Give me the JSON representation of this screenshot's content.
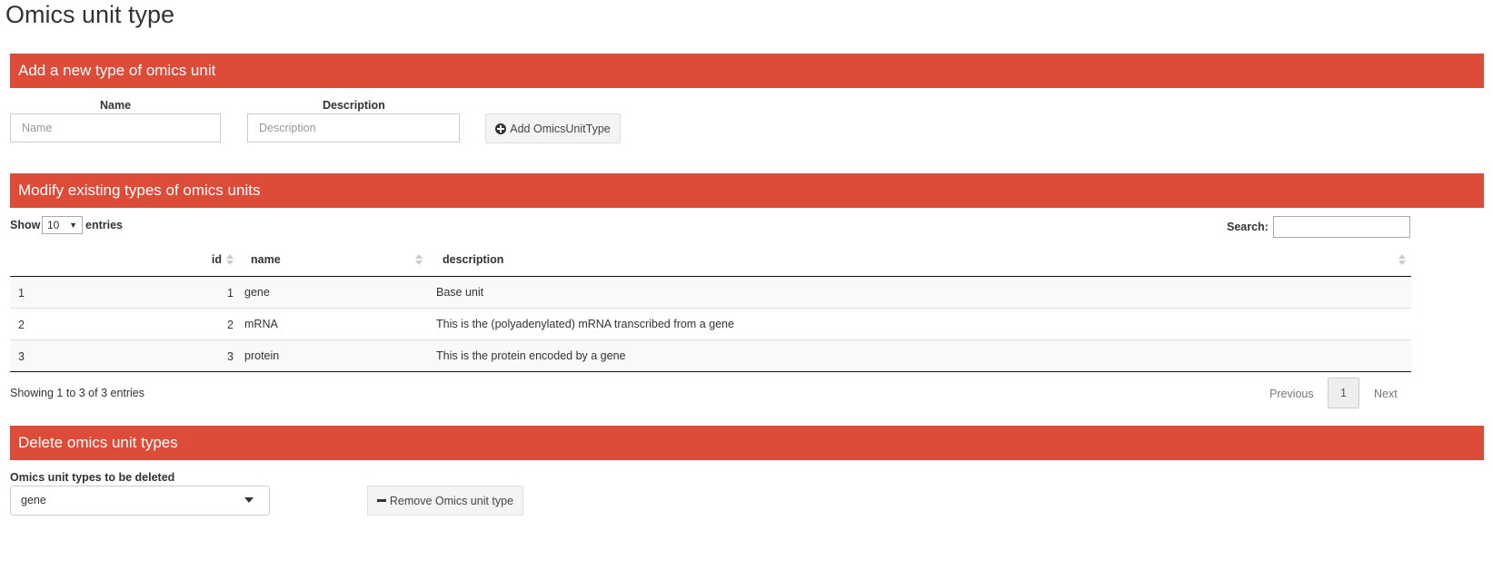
{
  "page": {
    "title": "Omics unit type"
  },
  "add_section": {
    "title": "Add a new type of omics unit",
    "name_label": "Name",
    "name_placeholder": "Name",
    "description_label": "Description",
    "description_placeholder": "Description",
    "add_button": "Add OmicsUnitType"
  },
  "modify_section": {
    "title": "Modify existing types of omics units",
    "show_label": "Show",
    "entries_value": "10",
    "entries_label": "entries",
    "search_label": "Search:",
    "columns": [
      "id",
      "name",
      "description"
    ],
    "rows": [
      {
        "row": "1",
        "id": "1",
        "name": "gene",
        "description": "Base unit"
      },
      {
        "row": "2",
        "id": "2",
        "name": "mRNA",
        "description": "This is the (polyadenylated) mRNA transcribed from a gene"
      },
      {
        "row": "3",
        "id": "3",
        "name": "protein",
        "description": "This is the protein encoded by a gene"
      }
    ],
    "info": "Showing 1 to 3 of 3 entries",
    "previous": "Previous",
    "page": "1",
    "next": "Next"
  },
  "delete_section": {
    "title": "Delete omics unit types",
    "select_label": "Omics unit types to be deleted",
    "selected": "gene",
    "remove_button": "Remove Omics unit type"
  }
}
